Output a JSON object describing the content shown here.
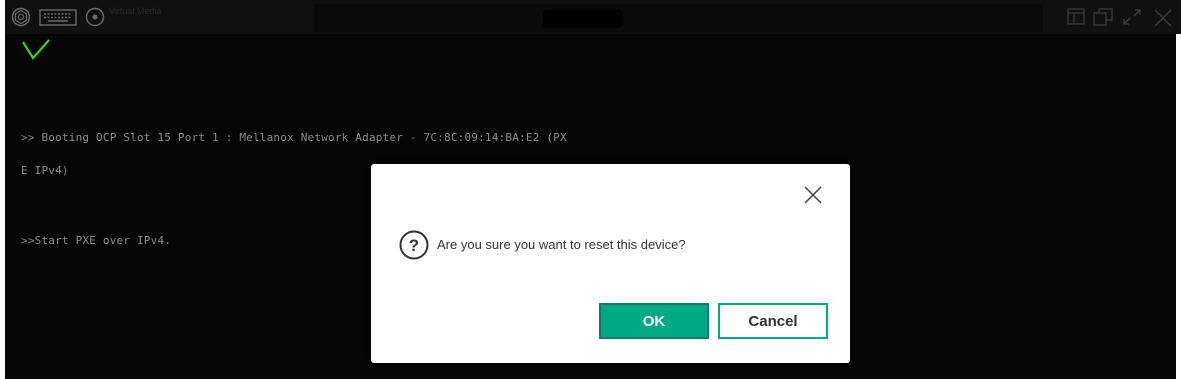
{
  "toolbar": {
    "console_label": "Virtual Media",
    "icons": [
      "settings-icon",
      "keyboard-icon",
      "media-icon"
    ],
    "right_icons": [
      "layout-icon",
      "window-icon",
      "expand-icon",
      "close-icon"
    ]
  },
  "console": {
    "lines": [
      ">> Booting OCP Slot 15 Port 1 : Mellanox Network Adapter - 7C:8C:09:14:BA:E2 (PX",
      "E IPv4)",
      ">>Start PXE over IPv4."
    ],
    "status_icon": "checkmark-icon"
  },
  "dialog": {
    "message": "Are you sure you want to reset this device?",
    "ok_label": "OK",
    "cancel_label": "Cancel",
    "icon": "question-icon"
  },
  "colors": {
    "accent": "#01a982",
    "check": "#37d317",
    "console_text": "#8c8c8c"
  }
}
